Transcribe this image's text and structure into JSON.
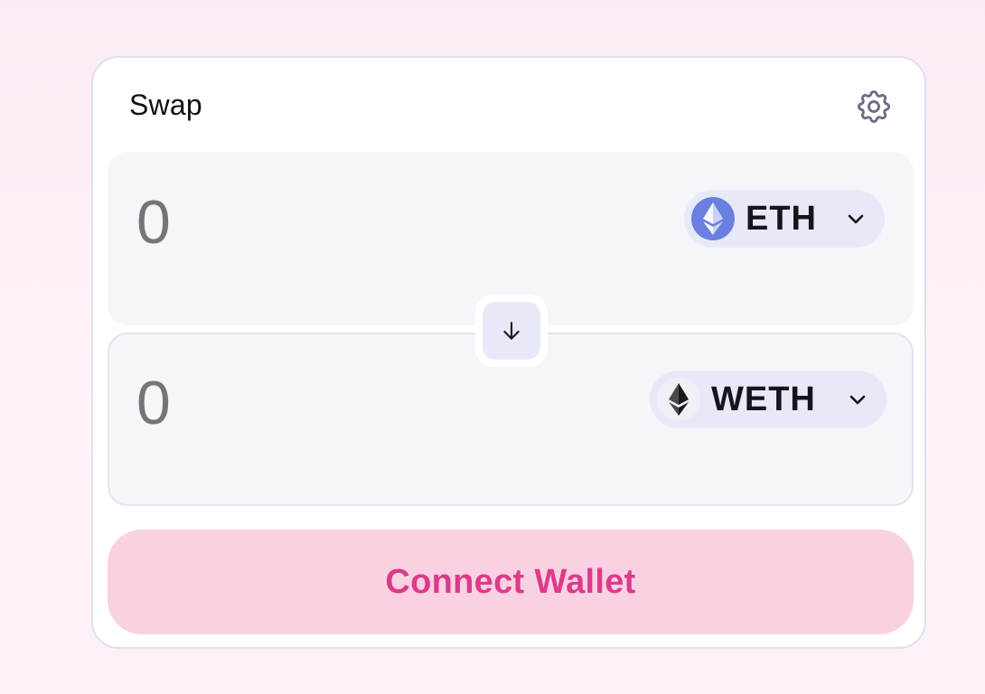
{
  "swap": {
    "title": "Swap",
    "settings_icon": "gear-icon",
    "input": {
      "amount_placeholder": "0",
      "token": {
        "symbol": "ETH",
        "icon": "eth-token-icon",
        "icon_color": "#6b7fe0"
      }
    },
    "switch_icon": "arrow-down-icon",
    "output": {
      "amount_placeholder": "0",
      "token": {
        "symbol": "WETH",
        "icon": "weth-token-icon",
        "icon_color": "#1f1f1f"
      }
    },
    "connect_button": "Connect Wallet"
  },
  "colors": {
    "accent": "#de3a8a",
    "button_bg": "#f9d1e3",
    "panel_bg": "#f5f6fa",
    "pill_bg": "#e8e9f8",
    "placeholder": "#9ea2ba"
  }
}
